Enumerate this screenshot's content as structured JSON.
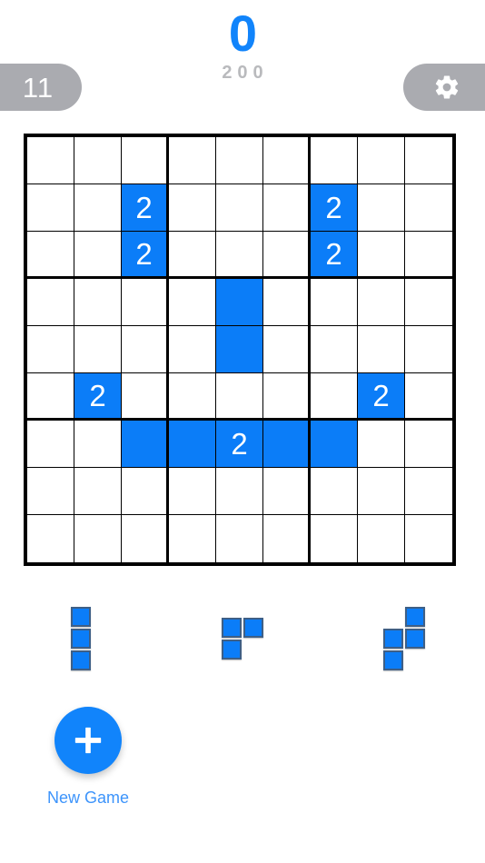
{
  "header": {
    "moves_badge": {
      "label": "11",
      "icon": "pill-badge",
      "background": "#aaabb0"
    },
    "score": {
      "current": "0",
      "target": "200",
      "color": "#1184fb",
      "target_color": "#b9babd"
    },
    "settings_button": {
      "icon": "gear-icon",
      "background": "#aaabb0"
    }
  },
  "board": {
    "rows": 9,
    "columns": 9,
    "block_size": 3,
    "empty_color": "#ffffff",
    "filled_color": "#0b7df8",
    "grid_line_color": "#000000",
    "cells": [
      [
        "",
        "",
        "",
        "",
        "",
        "",
        "",
        "",
        ""
      ],
      [
        "",
        "",
        "2",
        "",
        "",
        "",
        "2",
        "",
        ""
      ],
      [
        "",
        "",
        "2",
        "",
        "",
        "",
        "2",
        "",
        ""
      ],
      [
        "",
        "",
        "",
        "",
        " ",
        "",
        "",
        "",
        ""
      ],
      [
        "",
        "",
        "",
        "",
        " ",
        "",
        "",
        "",
        ""
      ],
      [
        "",
        "2",
        "",
        "",
        "",
        "",
        "",
        "2",
        ""
      ],
      [
        "",
        "",
        " ",
        " ",
        "2",
        " ",
        " ",
        "",
        ""
      ],
      [
        "",
        "",
        "",
        "",
        "",
        "",
        "",
        "",
        ""
      ],
      [
        "",
        "",
        "",
        "",
        "",
        "",
        "",
        "",
        ""
      ]
    ],
    "filled": [
      [
        false,
        false,
        false,
        false,
        false,
        false,
        false,
        false,
        false
      ],
      [
        false,
        false,
        true,
        false,
        false,
        false,
        true,
        false,
        false
      ],
      [
        false,
        false,
        true,
        false,
        false,
        false,
        true,
        false,
        false
      ],
      [
        false,
        false,
        false,
        false,
        true,
        false,
        false,
        false,
        false
      ],
      [
        false,
        false,
        false,
        false,
        true,
        false,
        false,
        false,
        false
      ],
      [
        false,
        true,
        false,
        false,
        false,
        false,
        false,
        true,
        false
      ],
      [
        false,
        false,
        true,
        true,
        true,
        true,
        true,
        false,
        false
      ],
      [
        false,
        false,
        false,
        false,
        false,
        false,
        false,
        false,
        false
      ],
      [
        false,
        false,
        false,
        false,
        false,
        false,
        false,
        false,
        false
      ]
    ]
  },
  "tray": {
    "pieces": [
      {
        "name": "piece-i-vertical",
        "columns": 1,
        "shape": [
          [
            1
          ],
          [
            1
          ],
          [
            1
          ]
        ]
      },
      {
        "name": "piece-l-tromino",
        "columns": 2,
        "shape": [
          [
            1,
            1
          ],
          [
            1,
            0
          ]
        ]
      },
      {
        "name": "piece-s-tetromino",
        "columns": 2,
        "shape": [
          [
            0,
            1
          ],
          [
            1,
            1
          ],
          [
            1,
            0
          ]
        ]
      }
    ]
  },
  "new_game": {
    "label": "New Game",
    "icon": "plus-icon",
    "color": "#1184fb",
    "label_color": "#3d94fb"
  }
}
